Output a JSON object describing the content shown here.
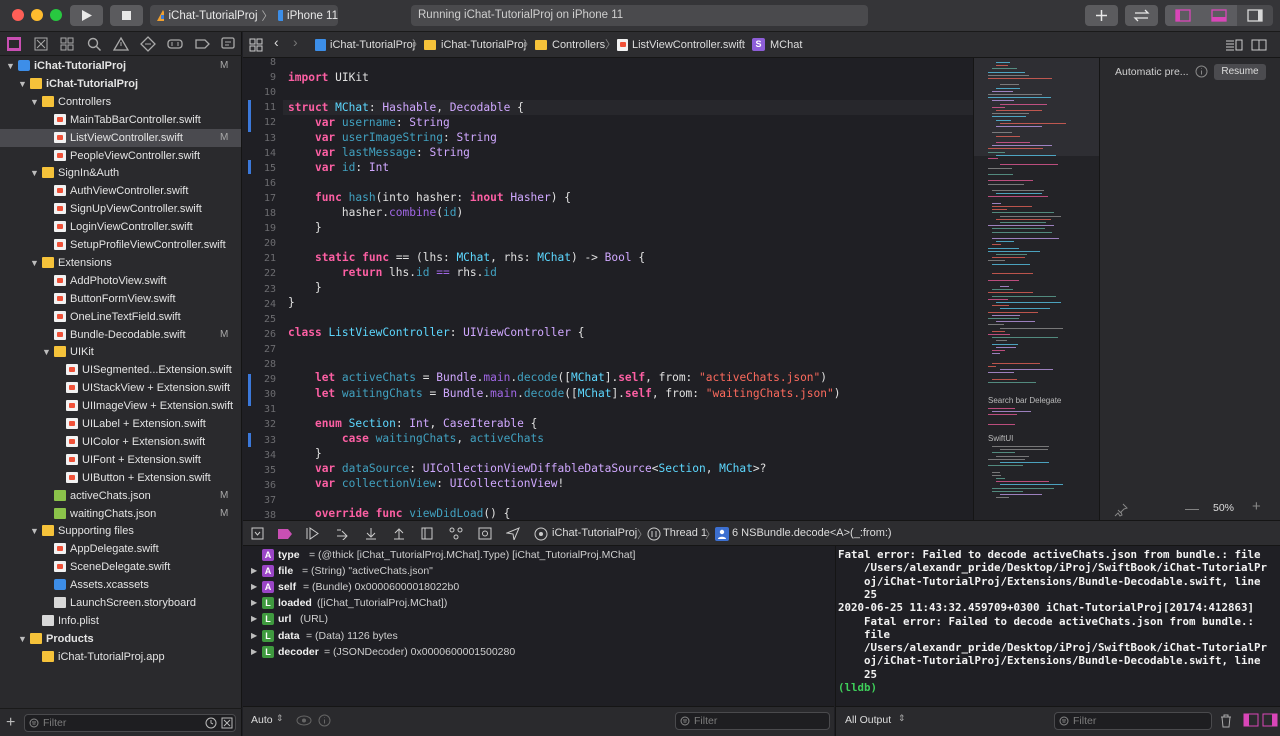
{
  "toolbar": {
    "scheme_project": "iChat-TutorialProj",
    "scheme_device": "iPhone 11",
    "status": "Running iChat-TutorialProj on iPhone 11"
  },
  "navigator": {
    "items": [
      {
        "label": "iChat-TutorialProj",
        "kind": "project",
        "badge": "M"
      },
      {
        "label": "iChat-TutorialProj",
        "kind": "folder",
        "badge": ""
      },
      {
        "label": "Controllers",
        "kind": "folder",
        "badge": ""
      },
      {
        "label": "MainTabBarController.swift",
        "kind": "swift",
        "badge": ""
      },
      {
        "label": "ListViewController.swift",
        "kind": "swift",
        "badge": "M"
      },
      {
        "label": "PeopleViewController.swift",
        "kind": "swift",
        "badge": ""
      },
      {
        "label": "SignIn&Auth",
        "kind": "folder",
        "badge": ""
      },
      {
        "label": "AuthViewController.swift",
        "kind": "swift",
        "badge": ""
      },
      {
        "label": "SignUpViewController.swift",
        "kind": "swift",
        "badge": ""
      },
      {
        "label": "LoginViewController.swift",
        "kind": "swift",
        "badge": ""
      },
      {
        "label": "SetupProfileViewController.swift",
        "kind": "swift",
        "badge": ""
      },
      {
        "label": "Extensions",
        "kind": "folder",
        "badge": ""
      },
      {
        "label": "AddPhotoView.swift",
        "kind": "swift",
        "badge": ""
      },
      {
        "label": "ButtonFormView.swift",
        "kind": "swift",
        "badge": ""
      },
      {
        "label": "OneLineTextField.swift",
        "kind": "swift",
        "badge": ""
      },
      {
        "label": "Bundle-Decodable.swift",
        "kind": "swift",
        "badge": "M"
      },
      {
        "label": "UIKit",
        "kind": "folder",
        "badge": ""
      },
      {
        "label": "UISegmented...Extension.swift",
        "kind": "swift",
        "badge": ""
      },
      {
        "label": "UIStackView + Extension.swift",
        "kind": "swift",
        "badge": ""
      },
      {
        "label": "UIImageView + Extension.swift",
        "kind": "swift",
        "badge": ""
      },
      {
        "label": "UILabel + Extension.swift",
        "kind": "swift",
        "badge": ""
      },
      {
        "label": "UIColor + Extension.swift",
        "kind": "swift",
        "badge": ""
      },
      {
        "label": "UIFont + Extension.swift",
        "kind": "swift",
        "badge": ""
      },
      {
        "label": "UIButton + Extension.swift",
        "kind": "swift",
        "badge": ""
      },
      {
        "label": "activeChats.json",
        "kind": "json",
        "badge": "M"
      },
      {
        "label": "waitingChats.json",
        "kind": "json",
        "badge": "M"
      },
      {
        "label": "Supporting files",
        "kind": "folder",
        "badge": ""
      },
      {
        "label": "AppDelegate.swift",
        "kind": "swift",
        "badge": ""
      },
      {
        "label": "SceneDelegate.swift",
        "kind": "swift",
        "badge": ""
      },
      {
        "label": "Assets.xcassets",
        "kind": "xcassets",
        "badge": ""
      },
      {
        "label": "LaunchScreen.storyboard",
        "kind": "storyboard",
        "badge": ""
      },
      {
        "label": "Info.plist",
        "kind": "plist",
        "badge": ""
      },
      {
        "label": "Products",
        "kind": "folder",
        "badge": ""
      },
      {
        "label": "iChat-TutorialProj.app",
        "kind": "app",
        "badge": ""
      }
    ],
    "filter_placeholder": "Filter"
  },
  "jumpbar": {
    "crumbs": [
      "iChat-TutorialProj",
      "iChat-TutorialProj",
      "Controllers",
      "ListViewController.swift",
      "MChat"
    ]
  },
  "editor": {
    "line_numbers": [
      "8",
      "9",
      "10",
      "11",
      "12",
      "13",
      "14",
      "15",
      "16",
      "17",
      "18",
      "19",
      "20",
      "21",
      "22",
      "23",
      "24",
      "25",
      "26",
      "27",
      "28",
      "29",
      "30",
      "31",
      "32",
      "33",
      "34",
      "35",
      "36",
      "37",
      "38"
    ]
  },
  "minimap": {
    "sections": [
      "Search bar Delegate",
      "SwiftUI"
    ]
  },
  "inspector": {
    "label": "Automatic pre...",
    "resume": "Resume",
    "zoom": "50%"
  },
  "debugbar": {
    "project": "iChat-TutorialProj",
    "thread": "Thread 1",
    "frame": "6 NSBundle.decode<A>(_:from:)"
  },
  "variables": [
    {
      "badge": "A",
      "name": "type",
      "value": "= (@thick [iChat_TutorialProj.MChat].Type) [iChat_TutorialProj.MChat]"
    },
    {
      "badge": "A",
      "name": "file",
      "value": "= (String) \"activeChats.json\""
    },
    {
      "badge": "A",
      "name": "self",
      "value": "= (Bundle) 0x00006000018022b0"
    },
    {
      "badge": "L",
      "name": "loaded",
      "value": "([iChat_TutorialProj.MChat])"
    },
    {
      "badge": "L",
      "name": "url",
      "value": "(URL)"
    },
    {
      "badge": "L",
      "name": "data",
      "value": "= (Data) 1126 bytes"
    },
    {
      "badge": "L",
      "name": "decoder",
      "value": "= (JSONDecoder) 0x0000600001500280"
    }
  ],
  "console": {
    "lines": [
      "Fatal error: Failed to decode activeChats.json from bundle.: file",
      "    /Users/alexandr_pride/Desktop/iProj/SwiftBook/iChat-TutorialPr",
      "    oj/iChat-TutorialProj/Extensions/Bundle-Decodable.swift, line",
      "    25",
      "2020-06-25 11:43:32.459709+0300 iChat-TutorialProj[20174:412863]",
      "    Fatal error: Failed to decode activeChats.json from bundle.:",
      "    file",
      "    /Users/alexandr_pride/Desktop/iProj/SwiftBook/iChat-TutorialPr",
      "    oj/iChat-TutorialProj/Extensions/Bundle-Decodable.swift, line",
      "    25"
    ],
    "prompt": "(lldb)"
  },
  "bottom": {
    "auto": "Auto",
    "var_filter_placeholder": "Filter",
    "output": "All Output",
    "console_filter_placeholder": "Filter"
  },
  "colors": {
    "accent": "#3b78d9",
    "keyword": "#fc5fa3",
    "type": "#5dd8ff",
    "string": "#fc6a5d"
  }
}
